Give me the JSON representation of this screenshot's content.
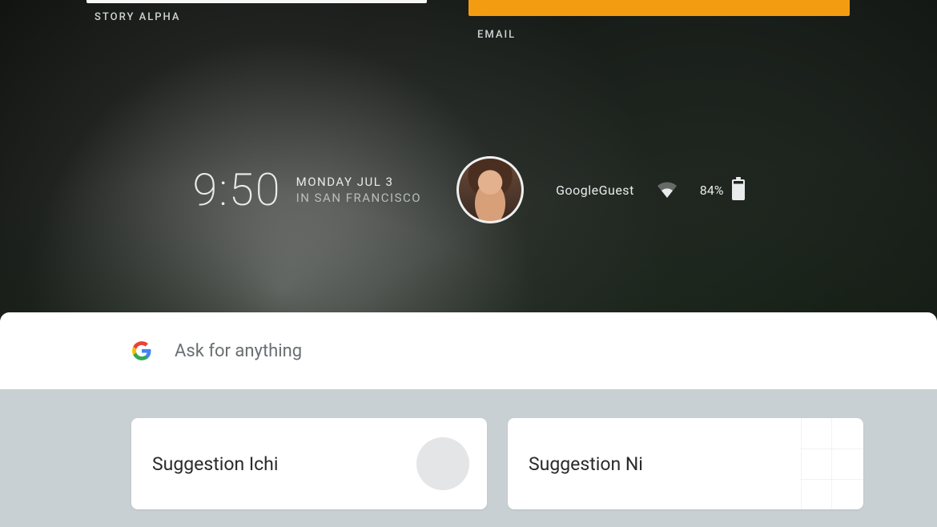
{
  "top": {
    "left_label": "STORY ALPHA",
    "right_label": "EMAIL"
  },
  "clock": {
    "time": "9:50",
    "date_line1": "MONDAY JUL 3",
    "date_line2": "IN SAN FRANCISCO"
  },
  "network": {
    "wifi_name": "GoogleGuest",
    "battery_percent": "84%"
  },
  "search": {
    "placeholder": "Ask for anything"
  },
  "suggestions": [
    {
      "label": "Suggestion Ichi"
    },
    {
      "label": "Suggestion Ni"
    }
  ],
  "colors": {
    "accent_orange": "#f39c12"
  }
}
